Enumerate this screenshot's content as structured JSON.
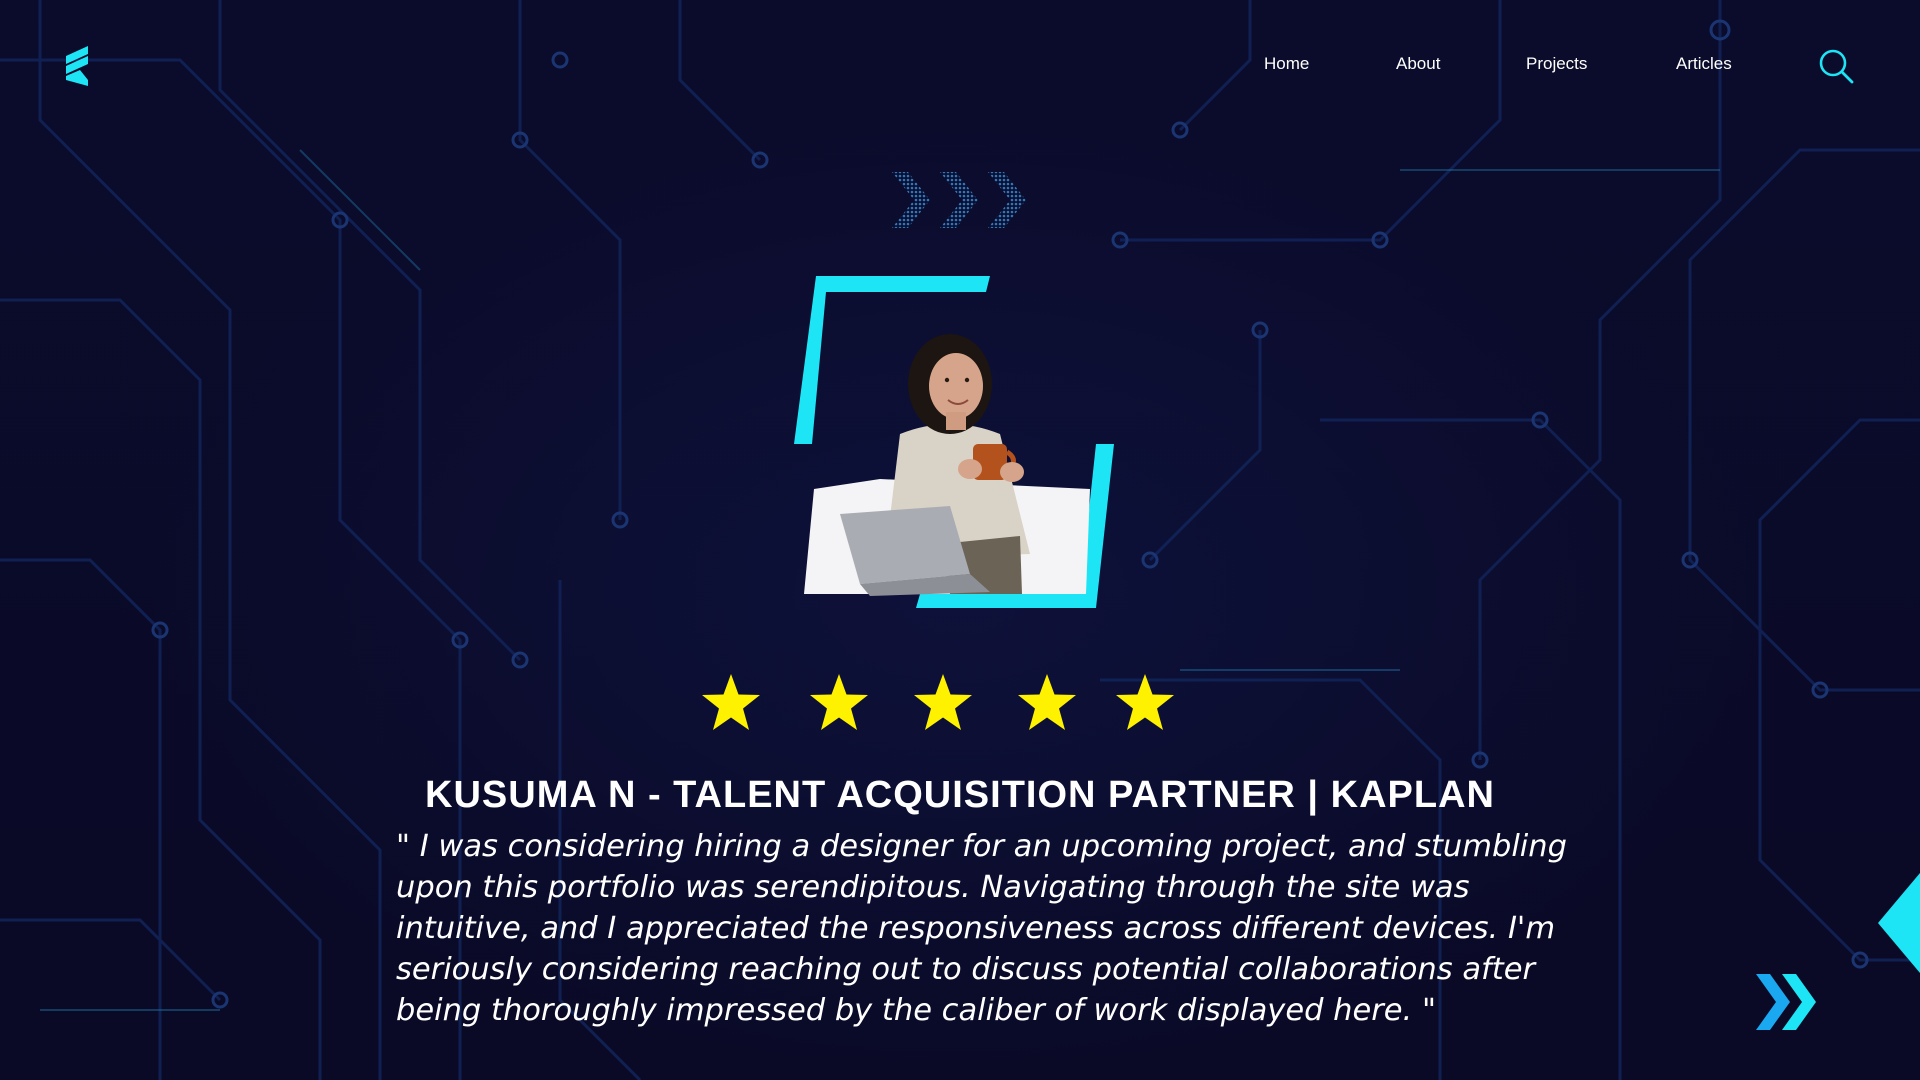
{
  "nav": {
    "items": [
      {
        "label": "Home"
      },
      {
        "label": "About"
      },
      {
        "label": "Projects"
      },
      {
        "label": "Articles"
      }
    ]
  },
  "icons": {
    "logo": "brand-logo-icon",
    "search": "search-icon",
    "chevrons": "triple-chevron-decoration-icon",
    "next": "double-chevron-right-icon",
    "star": "star-icon"
  },
  "testimonial": {
    "rating": 5,
    "rating_max": 5,
    "name": "KUSUMA N - TALENT ACQUISITION PARTNER | KAPLAN",
    "quote": "\" I was considering hiring a designer for an upcoming project, and stumbling upon this portfolio was serendipitous. Navigating through the site was intuitive, and I appreciated the responsiveness across different devices. I'm seriously considering reaching out to discuss potential collaborations after being thoroughly impressed by the caliber of work displayed here. \""
  },
  "colors": {
    "background": "#0a0a28",
    "accent": "#1de5f5",
    "star": "#fff200",
    "text": "#ffffff"
  }
}
